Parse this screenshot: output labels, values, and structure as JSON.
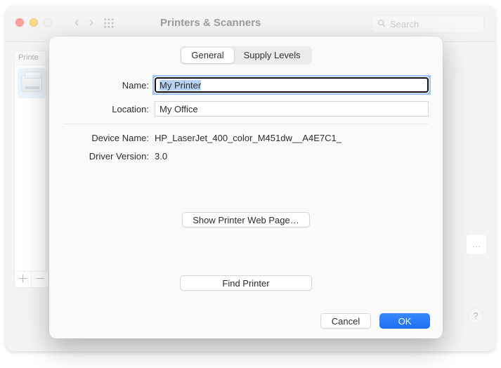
{
  "window": {
    "title": "Printers & Scanners",
    "search_placeholder": "Search"
  },
  "sidebar": {
    "header": "Printe",
    "add": "＋",
    "remove": "－",
    "ellipsis": "…"
  },
  "sheet": {
    "tabs": {
      "general": "General",
      "supply": "Supply Levels"
    },
    "labels": {
      "name": "Name:",
      "location": "Location:",
      "device_name": "Device Name:",
      "driver_version": "Driver Version:"
    },
    "values": {
      "name": "My Printer",
      "location": "My Office",
      "device_name": "HP_LaserJet_400_color_M451dw__A4E7C1_",
      "driver_version": "3.0"
    },
    "buttons": {
      "show_web": "Show Printer Web Page…",
      "find_printer": "Find Printer",
      "cancel": "Cancel",
      "ok": "OK"
    }
  },
  "help": "?"
}
